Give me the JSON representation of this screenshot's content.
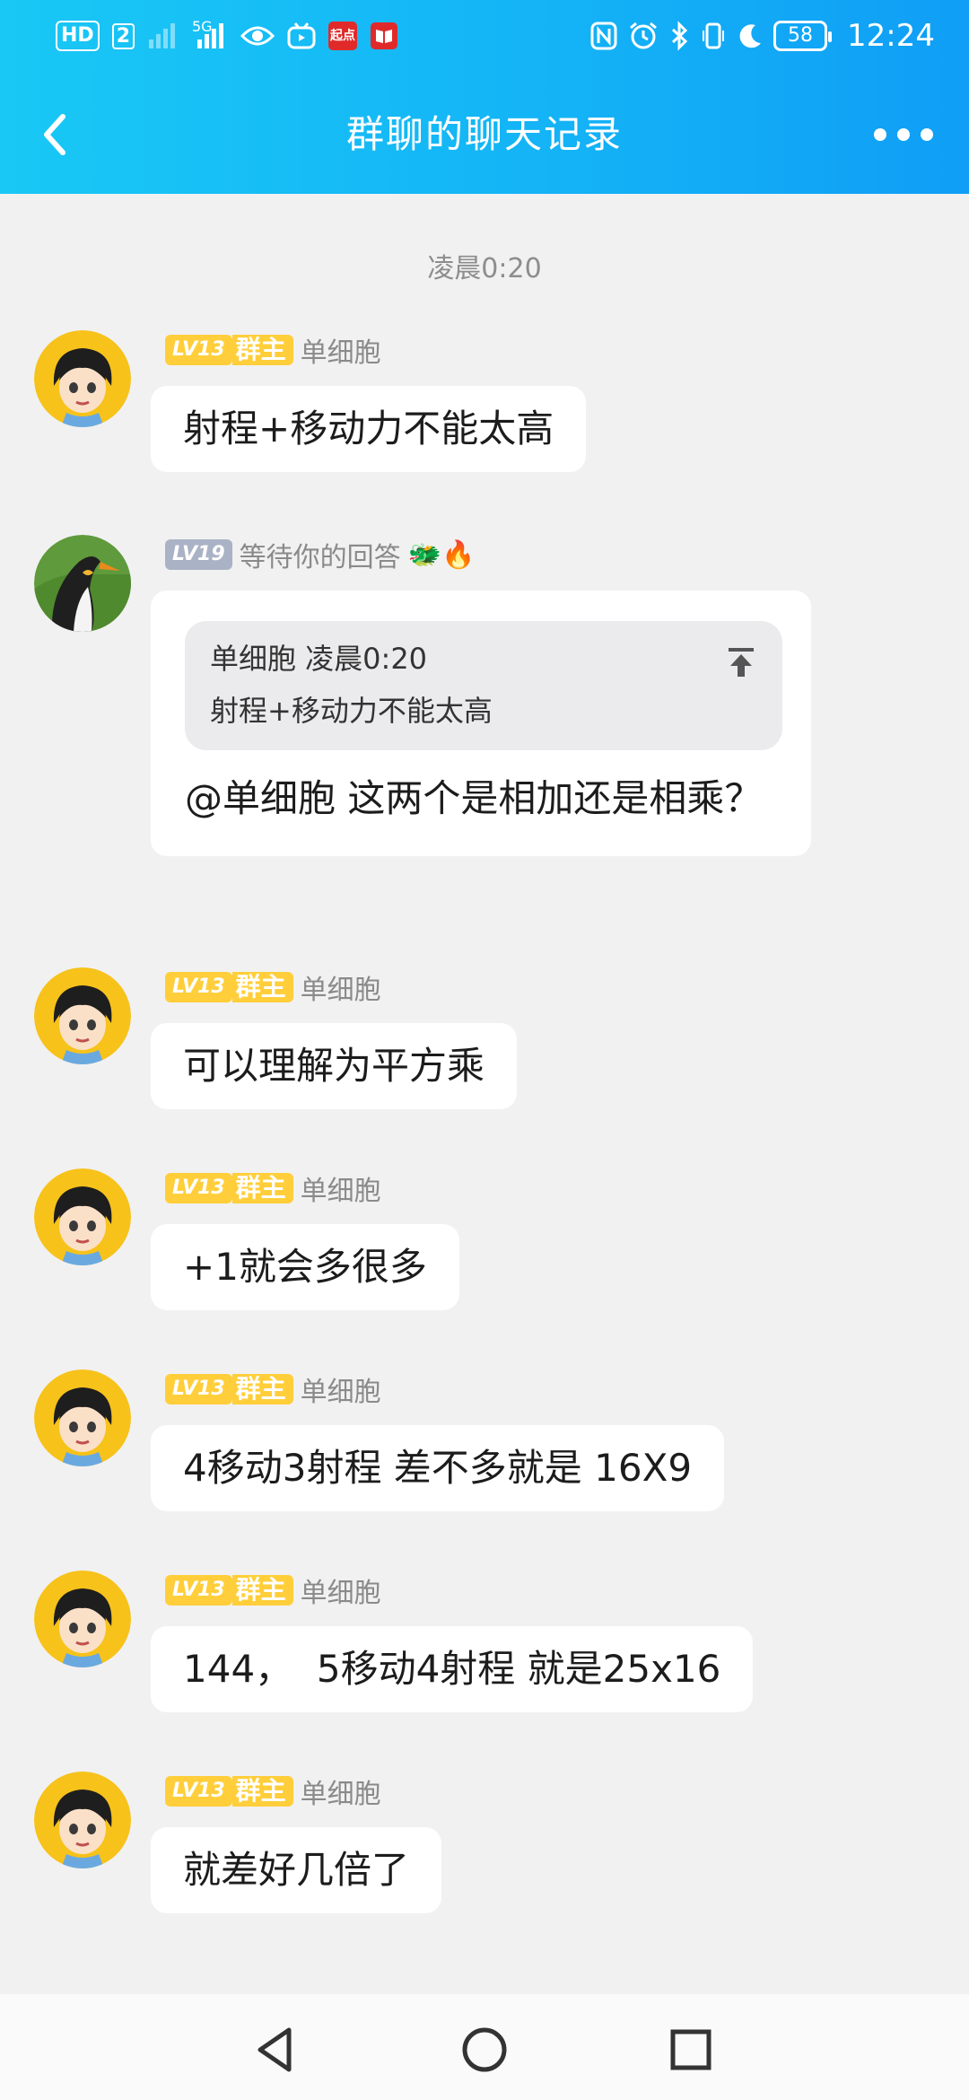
{
  "status_bar": {
    "hd_label": "HD",
    "sim_label": "2",
    "network_label": "5G",
    "app_icon_label": "起点",
    "battery": "58",
    "time": "12:24",
    "left_icons": [
      "hd-icon",
      "signal-weak-icon",
      "signal-5g-icon",
      "eye-icon",
      "bilibili-icon",
      "qidian-icon",
      "book-icon"
    ],
    "right_icons": [
      "nfc-icon",
      "alarm-icon",
      "bluetooth-icon",
      "vibrate-icon",
      "moon-icon",
      "battery-icon"
    ]
  },
  "header": {
    "title": "群聊的聊天记录",
    "back_icon": "chevron-left-icon",
    "more_icon": "more-dots-icon"
  },
  "chat": {
    "timestamp": "凌晨0:20",
    "messages": [
      {
        "level": "LV13",
        "role": "群主",
        "name": "单细胞",
        "text": "射程+移动力不能太高",
        "avatar": "boy-avatar"
      },
      {
        "level": "LV19",
        "role": "",
        "name": "等待你的回答",
        "emoji": "🐲🔥",
        "avatar": "penguin-avatar",
        "quote": {
          "header": "单细胞 凌晨0:20",
          "text": "射程+移动力不能太高"
        },
        "text": "@单细胞 这两个是相加还是相乘？"
      },
      {
        "level": "LV13",
        "role": "群主",
        "name": "单细胞",
        "text": "可以理解为平方乘",
        "avatar": "boy-avatar"
      },
      {
        "level": "LV13",
        "role": "群主",
        "name": "单细胞",
        "text": "+1就会多很多",
        "avatar": "boy-avatar"
      },
      {
        "level": "LV13",
        "role": "群主",
        "name": "单细胞",
        "text": "4移动3射程 差不多就是 16X9",
        "avatar": "boy-avatar"
      },
      {
        "level": "LV13",
        "role": "群主",
        "name": "单细胞",
        "text": "144，  5移动4射程 就是25x16",
        "avatar": "boy-avatar"
      },
      {
        "level": "LV13",
        "role": "群主",
        "name": "单细胞",
        "text": "就差好几倍了",
        "avatar": "boy-avatar"
      }
    ]
  },
  "nav_bar": {
    "buttons": [
      "back-triangle-icon",
      "home-circle-icon",
      "recents-square-icon"
    ]
  },
  "colors": {
    "header_start": "#19c8f5",
    "header_end": "#109ef6",
    "level_gold": "#ffce3a",
    "level_grey": "#aab2c6",
    "background": "#f1f1f1"
  }
}
